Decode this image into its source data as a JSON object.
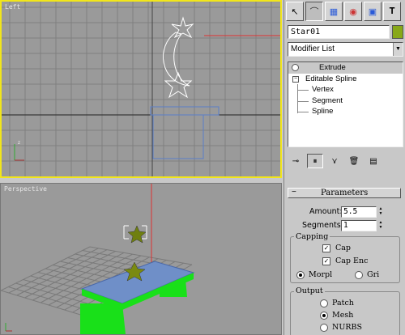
{
  "viewports": {
    "left_label": "Left",
    "perspective_label": "Perspective"
  },
  "command_panel": {
    "tabs": [
      {
        "icon": "cursor-arrow-icon"
      },
      {
        "icon": "modify-bend-icon"
      },
      {
        "icon": "hierarchy-icon"
      },
      {
        "icon": "motion-icon"
      },
      {
        "icon": "display-icon"
      },
      {
        "icon": "utilities-hammer-icon"
      }
    ],
    "object_name": "Star01",
    "object_color": "#88a818",
    "modifier_list": "Modifier List",
    "stack": {
      "top": "Extrude",
      "base": "Editable Spline",
      "sub": [
        "Vertex",
        "Segment",
        "Spline"
      ]
    },
    "parameters": {
      "title": "Parameters",
      "amount_label": "Amount:",
      "amount_value": "5.5",
      "segments_label": "Segments:",
      "segments_value": "1",
      "capping_title": "Capping",
      "cap_start": "Cap",
      "cap_end": "Cap Enc",
      "morph": "Morpl",
      "grid": "Gri",
      "output_title": "Output",
      "patch": "Patch",
      "mesh": "Mesh",
      "nurbs": "NURBS"
    }
  }
}
